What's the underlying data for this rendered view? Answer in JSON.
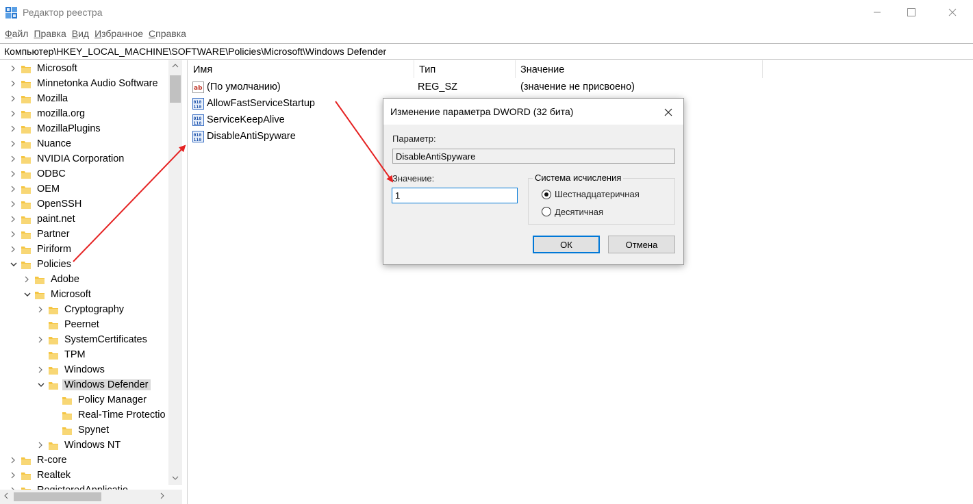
{
  "window": {
    "title": "Редактор реестра"
  },
  "menu": [
    {
      "accel": "Ф",
      "rest": "айл"
    },
    {
      "accel": "П",
      "rest": "равка"
    },
    {
      "accel": "В",
      "rest": "ид"
    },
    {
      "accel": "И",
      "rest": "збранное"
    },
    {
      "accel": "С",
      "rest": "правка"
    }
  ],
  "address": "Компьютер\\HKEY_LOCAL_MACHINE\\SOFTWARE\\Policies\\Microsoft\\Windows Defender",
  "tree": [
    {
      "label": "Microsoft",
      "expander": "collapsed"
    },
    {
      "label": "Minnetonka Audio Software",
      "expander": "collapsed"
    },
    {
      "label": "Mozilla",
      "expander": "collapsed"
    },
    {
      "label": "mozilla.org",
      "expander": "collapsed"
    },
    {
      "label": "MozillaPlugins",
      "expander": "collapsed"
    },
    {
      "label": "Nuance",
      "expander": "collapsed"
    },
    {
      "label": "NVIDIA Corporation",
      "expander": "collapsed"
    },
    {
      "label": "ODBC",
      "expander": "collapsed"
    },
    {
      "label": "OEM",
      "expander": "collapsed"
    },
    {
      "label": "OpenSSH",
      "expander": "collapsed"
    },
    {
      "label": "paint.net",
      "expander": "collapsed"
    },
    {
      "label": "Partner",
      "expander": "collapsed"
    },
    {
      "label": "Piriform",
      "expander": "collapsed"
    },
    {
      "label": "Policies",
      "expander": "expanded"
    },
    {
      "label": "Adobe",
      "expander": "collapsed"
    },
    {
      "label": "Microsoft",
      "expander": "expanded"
    },
    {
      "label": "Cryptography",
      "expander": "collapsed"
    },
    {
      "label": "Peernet",
      "expander": "none"
    },
    {
      "label": "SystemCertificates",
      "expander": "collapsed"
    },
    {
      "label": "TPM",
      "expander": "none"
    },
    {
      "label": "Windows",
      "expander": "collapsed"
    },
    {
      "label": "Windows Defender",
      "expander": "expanded",
      "selected": true
    },
    {
      "label": "Policy Manager",
      "expander": "none"
    },
    {
      "label": "Real-Time Protectio",
      "expander": "none"
    },
    {
      "label": "Spynet",
      "expander": "none"
    },
    {
      "label": "Windows NT",
      "expander": "collapsed"
    },
    {
      "label": "R-core",
      "expander": "collapsed"
    },
    {
      "label": "Realtek",
      "expander": "collapsed"
    },
    {
      "label": "RegisteredApplicatio",
      "expander": "collapsed"
    }
  ],
  "columns": {
    "name": "Имя",
    "type": "Тип",
    "data": "Значение"
  },
  "values": [
    {
      "name": "(По умолчанию)",
      "type": "REG_SZ",
      "data": "(значение не присвоено)",
      "icon": "string-value-icon"
    },
    {
      "name": "AllowFastServiceStartup",
      "type": "",
      "data": "",
      "icon": "dword-value-icon"
    },
    {
      "name": "ServiceKeepAlive",
      "type": "",
      "data": "",
      "icon": "dword-value-icon"
    },
    {
      "name": "DisableAntiSpyware",
      "type": "",
      "data": "",
      "icon": "dword-value-icon"
    }
  ],
  "dialog": {
    "title": "Изменение параметра DWORD (32 бита)",
    "param_label": "Параметр:",
    "param_value": "DisableAntiSpyware",
    "value_label": "Значение:",
    "value": "1",
    "base_label": "Система исчисления",
    "radio_hex": "Шестнадцатеричная",
    "radio_dec": "Десятичная",
    "selected_base": "hex",
    "ok": "ОК",
    "cancel": "Отмена"
  },
  "colors": {
    "annotation_arrow": "#e52222",
    "folder": "#f5c542",
    "accent": "#0078d7"
  }
}
